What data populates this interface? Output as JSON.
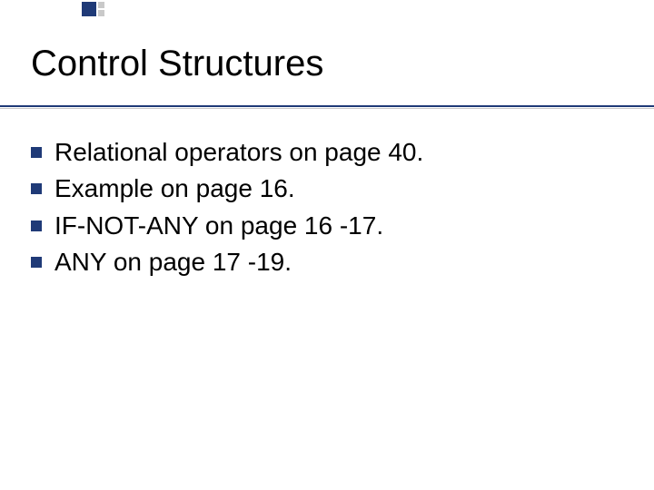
{
  "title": "Control Structures",
  "bullets": [
    "Relational operators on page 40.",
    "Example on page 16.",
    "IF-NOT-ANY on page 16 -17.",
    "ANY on page 17 -19."
  ]
}
